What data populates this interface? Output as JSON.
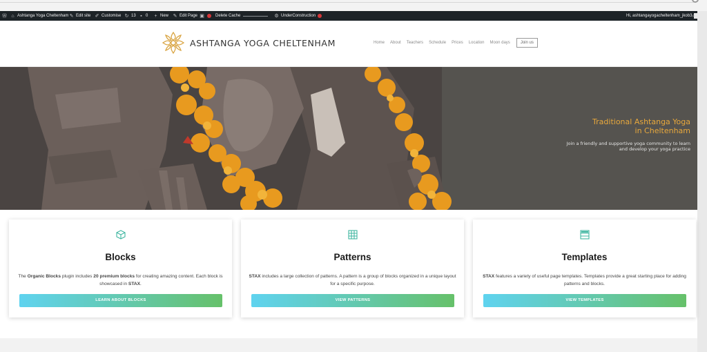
{
  "colors": {
    "accent_gold": "#e8a83c",
    "button_start": "#5fd3ef",
    "button_end": "#66c16a",
    "adminbar": "#1d2327",
    "icon_teal": "#3fb6a0"
  },
  "adminbar": {
    "wp_icon": "wordpress-icon",
    "site_name": "Ashtanga Yoga Cheltenham",
    "edit_site": "Edit site",
    "customise": "Customise",
    "updates_count": "13",
    "comments_count": "0",
    "new": "New",
    "edit_page": "Edit Page",
    "delete_cache": "Delete Cache",
    "under_construction": "UnderConstruction",
    "greeting": "Hi, ashtangayogacheltenham_jkob3"
  },
  "header": {
    "logo_text": "ASHTANGA YOGA CHELTENHAM",
    "nav": [
      "Home",
      "About",
      "Teachers",
      "Schedule",
      "Prices",
      "Location",
      "Moon days"
    ],
    "join": "Join us"
  },
  "hero": {
    "title_line1": "Traditional Ashtanga Yoga",
    "title_line2": "in Cheltenham",
    "sub_line1": "Join a friendly and supportive yoga community to learn",
    "sub_line2": "and develop your yoga practice"
  },
  "cards": [
    {
      "icon": "cube-icon",
      "title": "Blocks",
      "text_a": "The ",
      "text_b": "Organic Blocks",
      "text_c": " plugin includes ",
      "text_d": "20 premium blocks",
      "text_e": " for creating amazing content. Each block is showcased in ",
      "text_f": "STAX",
      "text_g": ".",
      "button": "LEARN ABOUT BLOCKS"
    },
    {
      "icon": "grid-pattern-icon",
      "title": "Patterns",
      "text_a": "",
      "text_b": "STAX",
      "text_c": " includes a large collection of patterns. A pattern is a group of blocks organized in a unique layout for a specific purpose.",
      "text_d": "",
      "text_e": "",
      "text_f": "",
      "text_g": "",
      "button": "VIEW PATTERNS"
    },
    {
      "icon": "template-icon",
      "title": "Templates",
      "text_a": "",
      "text_b": "STAX",
      "text_c": " features a variety of useful page templates. Templates provide a great starting place for adding patterns and blocks.",
      "text_d": "",
      "text_e": "",
      "text_f": "",
      "text_g": "",
      "button": "VIEW TEMPLATES"
    }
  ]
}
